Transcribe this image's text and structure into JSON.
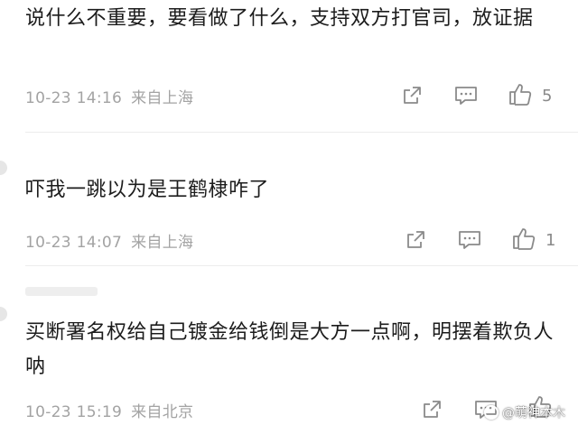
{
  "comments": [
    {
      "text": "说什么不重要，要看做了什么，支持双方打官司，放证据",
      "time": "10-23 14:16",
      "location": "来自上海",
      "likes": "5"
    },
    {
      "text": "吓我一跳以为是王鹤棣咋了",
      "time": "10-23 14:07",
      "location": "来自上海",
      "likes": "1"
    },
    {
      "text": "买断署名权给自己镀金给钱倒是大方一点啊，明摆着欺负人呐",
      "time": "10-23 15:19",
      "location": "来自北京",
      "likes": ""
    }
  ],
  "icons": {
    "share": "share-icon",
    "reply": "comment-icon",
    "like": "thumbs-up-icon"
  },
  "watermark": "@萌神本木",
  "colors": {
    "text": "#1c1c1c",
    "meta": "#a3a3a3",
    "icon": "#8a8a8a",
    "divider": "#ececec"
  }
}
